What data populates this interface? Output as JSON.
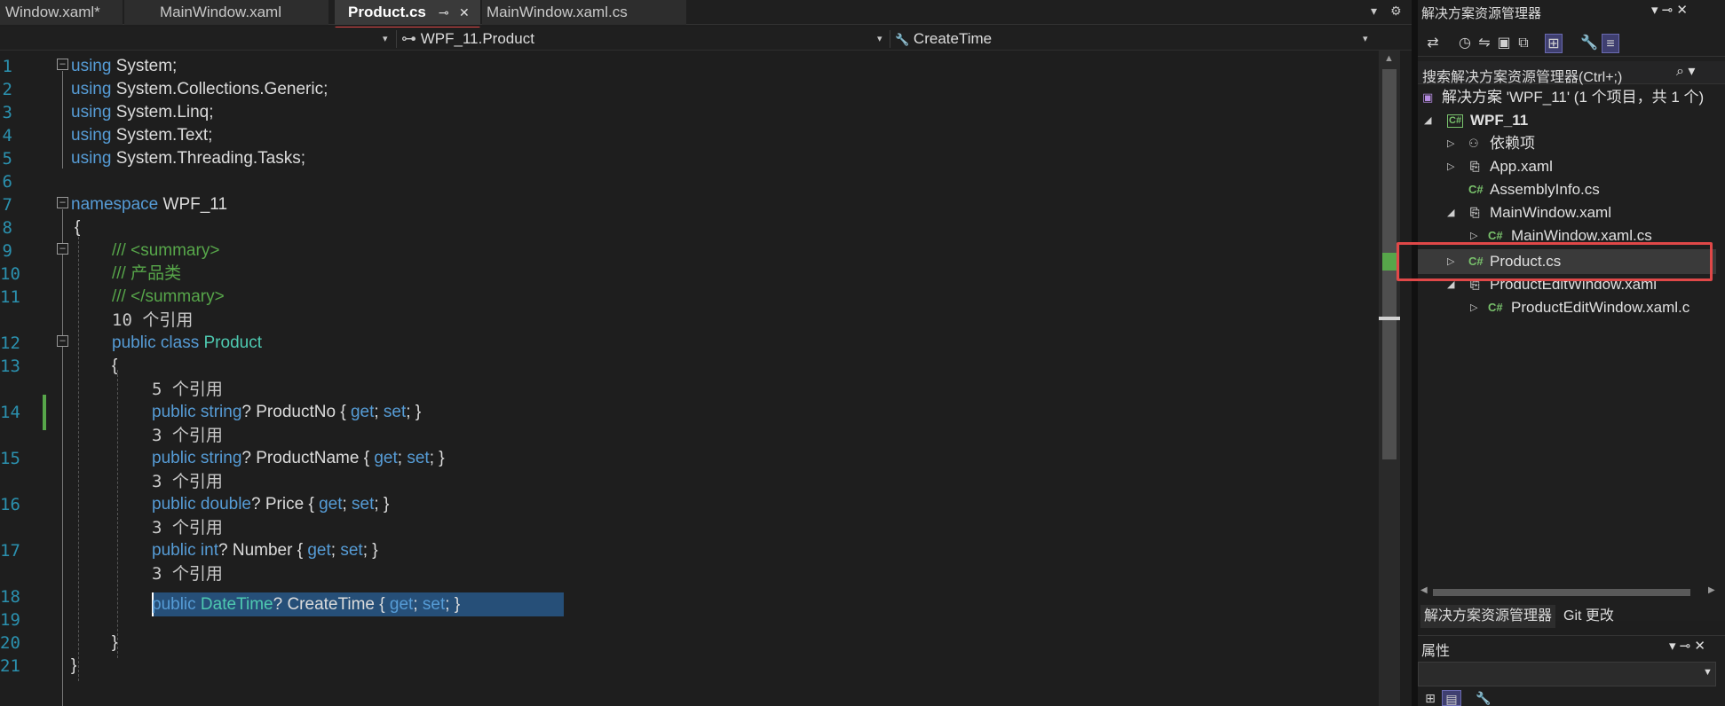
{
  "tabs": [
    {
      "label": "Window.xaml*"
    },
    {
      "label": "MainWindow.xaml"
    },
    {
      "label": "Product.cs"
    },
    {
      "label": "MainWindow.xaml.cs"
    }
  ],
  "tab_icons": {
    "pin": "⊸",
    "close": "✕",
    "overflow": "▾",
    "settings": "⚙"
  },
  "navbar": {
    "project_caret": "▾",
    "class_icon": "⊶",
    "class_name": "WPF_11.Product",
    "member_icon": "🔧",
    "member_name": "CreateTime",
    "caret": "▾"
  },
  "code_lines": [
    {
      "n": "1"
    },
    {
      "n": "2"
    },
    {
      "n": "3"
    },
    {
      "n": "4"
    },
    {
      "n": "5"
    },
    {
      "n": "6"
    },
    {
      "n": "7"
    },
    {
      "n": "8"
    },
    {
      "n": "9"
    },
    {
      "n": "10"
    },
    {
      "n": "11"
    },
    {
      "n": "12"
    },
    {
      "n": "13"
    },
    {
      "n": "14"
    },
    {
      "n": "15"
    },
    {
      "n": "16"
    },
    {
      "n": "17"
    },
    {
      "n": "18"
    },
    {
      "n": "19"
    },
    {
      "n": "20"
    },
    {
      "n": "21"
    }
  ],
  "code": {
    "kw_using": "using",
    "ns_system": " System;",
    "ns_generic": " System.Collections.Generic;",
    "ns_linq": " System.Linq;",
    "ns_text": " System.Text;",
    "ns_tasks": " System.Threading.Tasks;",
    "kw_namespace": "namespace",
    "namespace_name": " WPF_11",
    "open_brace": "{",
    "close_brace": "}",
    "doc_summary_open": "/// <summary>",
    "doc_text": "/// 产品类",
    "doc_summary_close": "/// </summary>",
    "lens_class": "10 个引用",
    "kw_public": "public",
    "kw_class": " class",
    "class_name": " Product",
    "lens_productno": "5 个引用",
    "lens_3": "3 个引用",
    "kw_string": " string",
    "kw_double": " double",
    "kw_int": " int",
    "ty_datetime": " DateTime",
    "q": "?",
    "prop_productno": " ProductNo ",
    "prop_productname": " ProductName ",
    "prop_price": " Price ",
    "prop_number": " Number ",
    "prop_createtime": " CreateTime ",
    "accessor_open": "{ ",
    "kw_get": "get",
    "semi_sp": "; ",
    "kw_set": "set",
    "accessor_close": "}"
  },
  "solution_explorer": {
    "title": "解决方案资源管理器",
    "title_icons": "▾ ⊸ ✕",
    "search_placeholder": "搜索解决方案资源管理器(Ctrl+;)",
    "search_icon": "⌕ ▾",
    "tree": [
      {
        "label": "解决方案 'WPF_11' (1 个项目，共 1 个)",
        "icon": "solution-icon"
      },
      {
        "label": "WPF_11",
        "icon": "csharp-project-icon"
      },
      {
        "label": "依赖项",
        "icon": "dependencies-icon"
      },
      {
        "label": "App.xaml",
        "icon": "xaml-file-icon"
      },
      {
        "label": "AssemblyInfo.cs",
        "icon": "csharp-file-icon"
      },
      {
        "label": "MainWindow.xaml",
        "icon": "xaml-file-icon"
      },
      {
        "label": "MainWindow.xaml.cs",
        "icon": "csharp-file-icon"
      },
      {
        "label": "Product.cs",
        "icon": "csharp-file-icon"
      },
      {
        "label": "ProductEditWindow.xaml",
        "icon": "xaml-file-icon"
      },
      {
        "label": "ProductEditWindow.xaml.c",
        "icon": "csharp-file-icon"
      }
    ],
    "bottom_tabs": [
      "解决方案资源管理器",
      "Git 更改"
    ]
  },
  "properties": {
    "title": "属性",
    "title_icons": "▾ ⊸ ✕"
  },
  "colors": {
    "keyword": "#569cd6",
    "type": "#4ec9b0",
    "comment": "#57a64a",
    "line_number": "#2b91af",
    "selection": "#264f78",
    "annotation_red": "#e04848"
  }
}
